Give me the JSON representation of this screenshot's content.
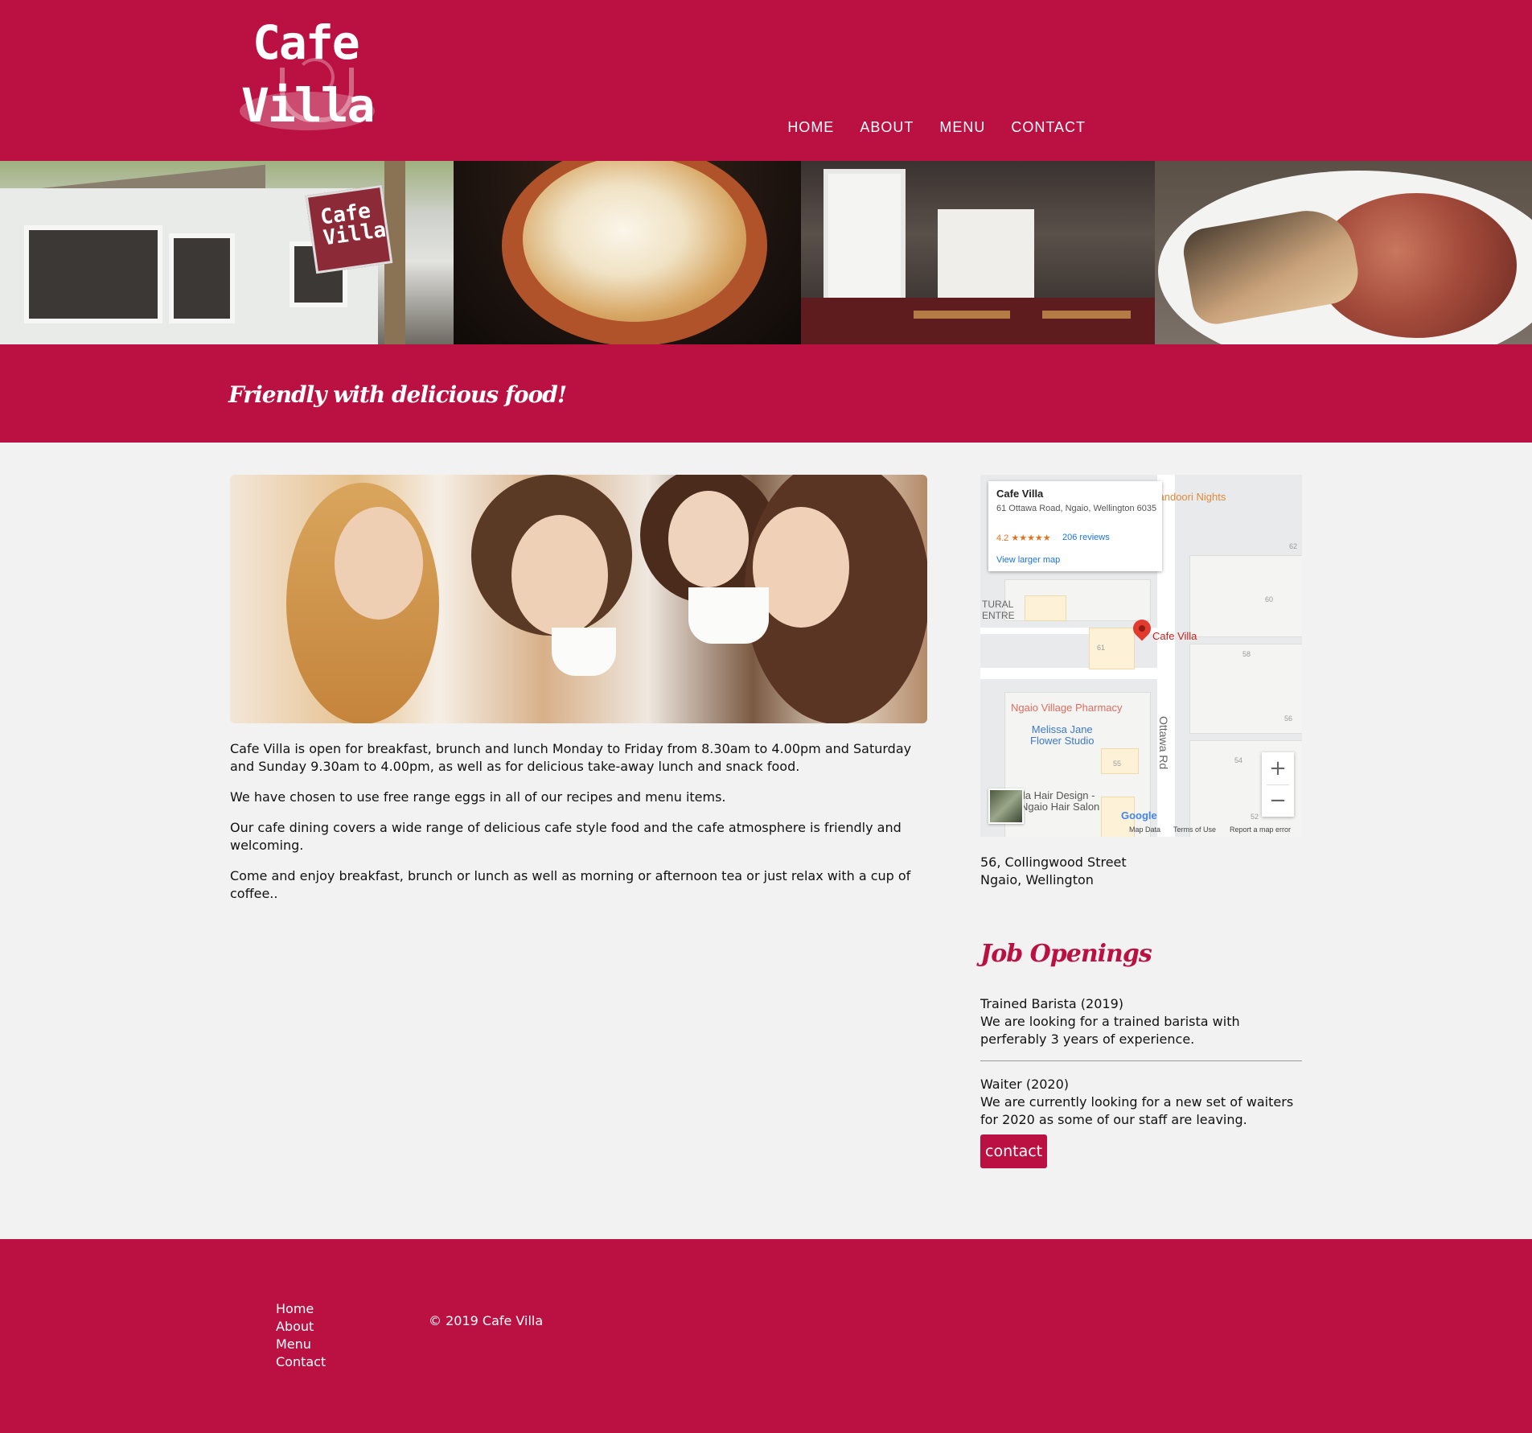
{
  "logo": {
    "line1": "Cafe",
    "line2": "Villa"
  },
  "nav": {
    "items": [
      "HOME",
      "ABOUT",
      "MENU",
      "CONTACT"
    ]
  },
  "banner": {
    "sign_text": "Cafe Villa"
  },
  "tagline": "Friendly with delicious food!",
  "intro": {
    "paragraphs": [
      "Cafe Villa is open for breakfast, brunch and lunch Monday to Friday from 8.30am to 4.00pm and Saturday and Sunday 9.30am to 4.00pm, as well as for delicious take-away lunch and snack food.",
      "We have chosen to use free range eggs in all of our recipes and menu items.",
      "Our cafe dining covers a wide range of delicious cafe style food and the cafe atmosphere is friendly and welcoming.",
      "Come and enjoy breakfast, brunch or lunch as well as morning or afternoon tea or just relax with a cup of coffee.."
    ]
  },
  "map": {
    "info_title": "Cafe Villa",
    "info_address": "61 Ottawa Road, Ngaio, Wellington 6035",
    "rating": "4.2 ★★★★★",
    "reviews": "206 reviews",
    "view_larger": "View larger map",
    "labels": {
      "tandoori": "Tandoori Nights",
      "cafe": "Cafe Villa",
      "pharmacy": "Ngaio Village Pharmacy",
      "melissa": "Melissa Jane\nFlower Studio",
      "hair": "lla Hair Design -\nNgaio Hair Salon",
      "tural": "TURAL\nENTRE",
      "road": "Ottawa Rd"
    },
    "numbers": [
      "62",
      "60",
      "61",
      "58",
      "56",
      "55",
      "54",
      "52"
    ],
    "footer": {
      "google": "Google",
      "map_data": "Map Data",
      "terms": "Terms of Use",
      "report": "Report a map error"
    },
    "zoom_in": "+",
    "zoom_out": "−"
  },
  "address": {
    "line1": "56, Collingwood Street",
    "line2": "Ngaio, Wellington"
  },
  "jobs": {
    "title": "Job Openings",
    "items": [
      {
        "title": "Trained Barista (2019)",
        "desc": "We are looking for a trained barista with perferably 3 years of experience."
      },
      {
        "title": "Waiter (2020)",
        "desc": "We are currently looking for a new set of waiters for 2020 as some of our staff are leaving."
      }
    ],
    "button": "contact"
  },
  "footer": {
    "links": [
      "Home",
      "About",
      "Menu",
      "Contact"
    ],
    "copyright": "© 2019 Cafe Villa"
  },
  "colors": {
    "brand": "#bb1142",
    "page_bg": "#f2f2f2"
  }
}
